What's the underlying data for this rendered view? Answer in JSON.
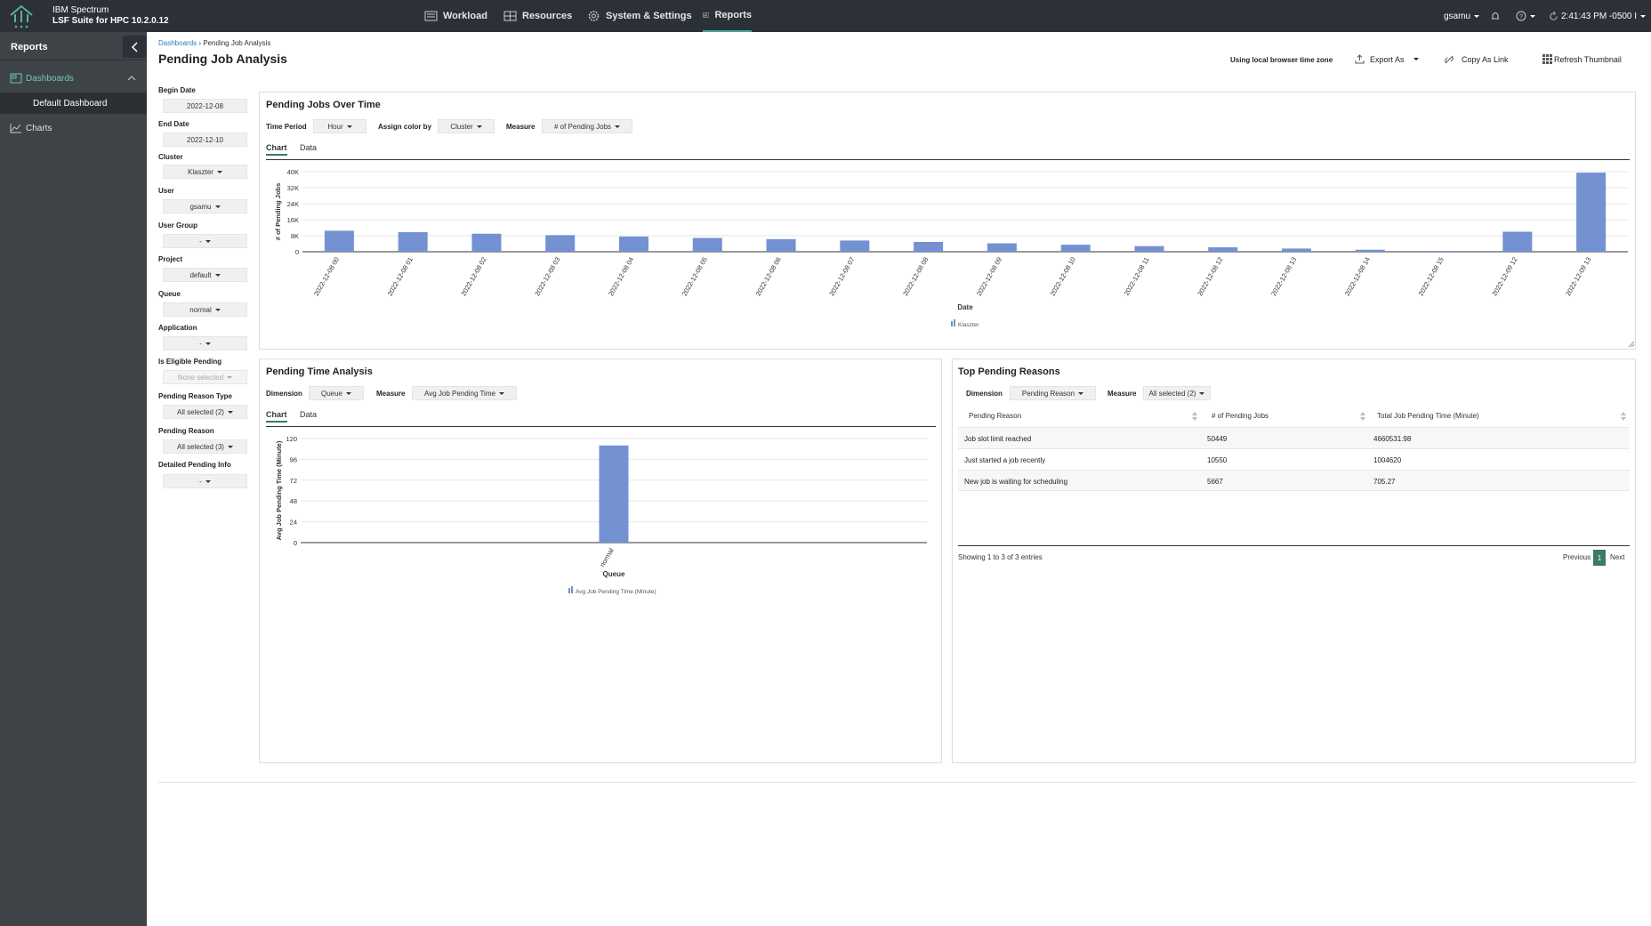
{
  "topbar": {
    "brand_line1": "IBM Spectrum",
    "brand_line2": "LSF Suite for HPC 10.2.0.12",
    "nav": [
      "Workload",
      "Resources",
      "System & Settings",
      "Reports"
    ],
    "user": "gsamu",
    "time": "2:41:43 PM -0500 I"
  },
  "sidebar": {
    "title": "Reports",
    "items": [
      {
        "label": "Dashboards"
      },
      {
        "label": "Default Dashboard"
      },
      {
        "label": "Charts"
      }
    ]
  },
  "header": {
    "breadcrumb_root": "Dashboards",
    "breadcrumb_current": "Pending Job Analysis",
    "title": "Pending Job Analysis",
    "timezone": "Using local browser time zone",
    "export": "Export As",
    "copy": "Copy As Link",
    "refresh": "Refresh Thumbnail"
  },
  "filters": [
    {
      "label": "Begin Date",
      "value": "2022-12-08"
    },
    {
      "label": "End Date",
      "value": "2022-12-10"
    },
    {
      "label": "Cluster",
      "value": "Klaszter"
    },
    {
      "label": "User",
      "value": "gsamu"
    },
    {
      "label": "User Group",
      "value": "-"
    },
    {
      "label": "Project",
      "value": "default"
    },
    {
      "label": "Queue",
      "value": "normal"
    },
    {
      "label": "Application",
      "value": "-"
    },
    {
      "label": "Is Eligible Pending",
      "value": "None selected"
    },
    {
      "label": "Pending Reason Type",
      "value": "All selected (2)"
    },
    {
      "label": "Pending Reason",
      "value": "All selected (3)"
    },
    {
      "label": "Detailed Pending Info",
      "value": "-"
    }
  ],
  "panel1": {
    "title": "Pending Jobs Over Time",
    "time_period_label": "Time Period",
    "time_period": "Hour",
    "color_label": "Assign color by",
    "color": "Cluster",
    "measure_label": "Measure",
    "measure": "# of Pending Jobs",
    "tabs": [
      "Chart",
      "Data"
    ]
  },
  "panel2": {
    "title": "Pending Time Analysis",
    "dimension_label": "Dimension",
    "dimension": "Queue",
    "measure_label": "Measure",
    "measure": "Avg Job Pending Time",
    "tabs": [
      "Chart",
      "Data"
    ]
  },
  "panel3": {
    "title": "Top Pending Reasons",
    "dimension_label": "Dimension",
    "dimension": "Pending Reason",
    "measure_label": "Measure",
    "measure": "All selected (2)",
    "columns": [
      "Pending Reason",
      "# of Pending Jobs",
      "Total Job Pending Time (Minute)"
    ],
    "rows": [
      [
        "Job slot limit reached",
        "50449",
        "4660531.98"
      ],
      [
        "Just started a job recently",
        "10550",
        "1004620"
      ],
      [
        "New job is waiting for scheduling",
        "5667",
        "705.27"
      ]
    ],
    "showing": "Showing 1 to 3 of 3 entries",
    "prev": "Previous",
    "page": "1",
    "next": "Next"
  },
  "colors": {
    "bar": "#7491d2",
    "accent": "#3b7a68",
    "topbar": "#2b3136",
    "sidebar": "#3e4347"
  },
  "chart_data": [
    {
      "type": "bar",
      "ylabel": "# of Pending Jobs",
      "xlabel": "Date",
      "ylim": [
        0,
        40000
      ],
      "yticks": [
        "0",
        "8K",
        "16K",
        "24K",
        "32K",
        "40K"
      ],
      "categories": [
        "2022-12-08 00",
        "2022-12-08 01",
        "2022-12-08 02",
        "2022-12-08 03",
        "2022-12-08 04",
        "2022-12-08 05",
        "2022-12-08 06",
        "2022-12-08 07",
        "2022-12-08 08",
        "2022-12-08 09",
        "2022-12-08 10",
        "2022-12-08 11",
        "2022-12-08 12",
        "2022-12-08 13",
        "2022-12-08 14",
        "2022-12-08 15",
        "2022-12-09 12",
        "2022-12-09 13"
      ],
      "series": [
        {
          "name": "Klaszter",
          "values": [
            10500,
            9800,
            9000,
            8300,
            7600,
            6900,
            6300,
            5600,
            4900,
            4200,
            3500,
            2800,
            2200,
            1600,
            1000,
            400,
            10000,
            39500
          ]
        }
      ]
    },
    {
      "type": "bar",
      "ylabel": "Avg Job Pending Time (Minute)",
      "xlabel": "Queue",
      "ylim": [
        0,
        120
      ],
      "yticks": [
        "0",
        "24",
        "48",
        "72",
        "96",
        "120"
      ],
      "categories": [
        "normal"
      ],
      "series": [
        {
          "name": "Avg Job Pending Time (Minute)",
          "values": [
            112
          ]
        }
      ]
    }
  ]
}
